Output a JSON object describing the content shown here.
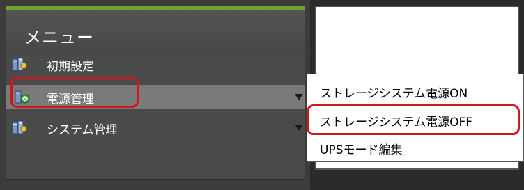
{
  "menu": {
    "title": "メニュー",
    "items": [
      {
        "label": "初期設定",
        "icon": "server-settings-icon"
      },
      {
        "label": "電源管理",
        "icon": "power-icon"
      },
      {
        "label": "システム管理",
        "icon": "server-settings-icon"
      }
    ]
  },
  "submenu": {
    "items": [
      {
        "label": "ストレージシステム電源ON"
      },
      {
        "label": "ストレージシステム電源OFF"
      },
      {
        "label": "UPSモード編集"
      }
    ]
  },
  "colors": {
    "accent": "#6fa331",
    "highlight": "#d01818",
    "selected_row": "#7a7a7a",
    "sidebar_bg": "#4a4a4a"
  }
}
